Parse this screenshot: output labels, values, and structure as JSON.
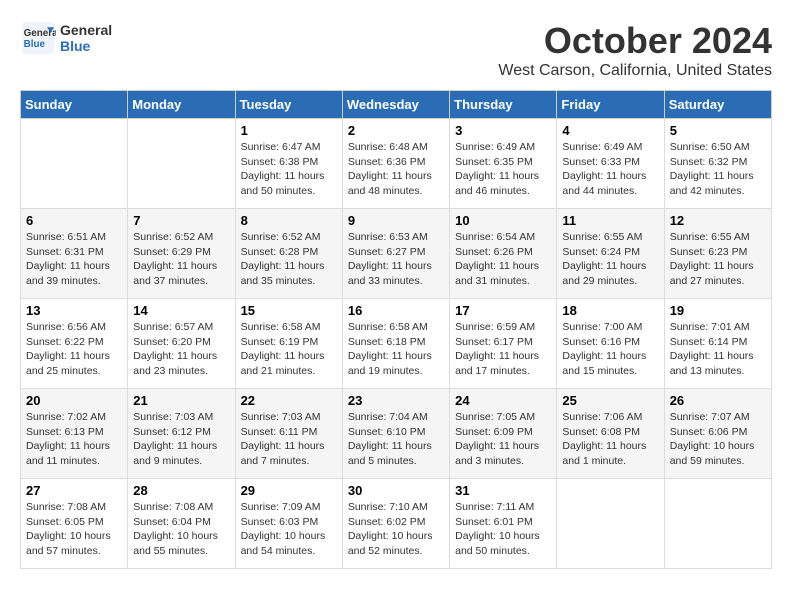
{
  "header": {
    "logo_line1": "General",
    "logo_line2": "Blue",
    "month": "October 2024",
    "location": "West Carson, California, United States"
  },
  "days_of_week": [
    "Sunday",
    "Monday",
    "Tuesday",
    "Wednesday",
    "Thursday",
    "Friday",
    "Saturday"
  ],
  "weeks": [
    [
      {
        "day": "",
        "content": ""
      },
      {
        "day": "",
        "content": ""
      },
      {
        "day": "1",
        "content": "Sunrise: 6:47 AM\nSunset: 6:38 PM\nDaylight: 11 hours and 50 minutes."
      },
      {
        "day": "2",
        "content": "Sunrise: 6:48 AM\nSunset: 6:36 PM\nDaylight: 11 hours and 48 minutes."
      },
      {
        "day": "3",
        "content": "Sunrise: 6:49 AM\nSunset: 6:35 PM\nDaylight: 11 hours and 46 minutes."
      },
      {
        "day": "4",
        "content": "Sunrise: 6:49 AM\nSunset: 6:33 PM\nDaylight: 11 hours and 44 minutes."
      },
      {
        "day": "5",
        "content": "Sunrise: 6:50 AM\nSunset: 6:32 PM\nDaylight: 11 hours and 42 minutes."
      }
    ],
    [
      {
        "day": "6",
        "content": "Sunrise: 6:51 AM\nSunset: 6:31 PM\nDaylight: 11 hours and 39 minutes."
      },
      {
        "day": "7",
        "content": "Sunrise: 6:52 AM\nSunset: 6:29 PM\nDaylight: 11 hours and 37 minutes."
      },
      {
        "day": "8",
        "content": "Sunrise: 6:52 AM\nSunset: 6:28 PM\nDaylight: 11 hours and 35 minutes."
      },
      {
        "day": "9",
        "content": "Sunrise: 6:53 AM\nSunset: 6:27 PM\nDaylight: 11 hours and 33 minutes."
      },
      {
        "day": "10",
        "content": "Sunrise: 6:54 AM\nSunset: 6:26 PM\nDaylight: 11 hours and 31 minutes."
      },
      {
        "day": "11",
        "content": "Sunrise: 6:55 AM\nSunset: 6:24 PM\nDaylight: 11 hours and 29 minutes."
      },
      {
        "day": "12",
        "content": "Sunrise: 6:55 AM\nSunset: 6:23 PM\nDaylight: 11 hours and 27 minutes."
      }
    ],
    [
      {
        "day": "13",
        "content": "Sunrise: 6:56 AM\nSunset: 6:22 PM\nDaylight: 11 hours and 25 minutes."
      },
      {
        "day": "14",
        "content": "Sunrise: 6:57 AM\nSunset: 6:20 PM\nDaylight: 11 hours and 23 minutes."
      },
      {
        "day": "15",
        "content": "Sunrise: 6:58 AM\nSunset: 6:19 PM\nDaylight: 11 hours and 21 minutes."
      },
      {
        "day": "16",
        "content": "Sunrise: 6:58 AM\nSunset: 6:18 PM\nDaylight: 11 hours and 19 minutes."
      },
      {
        "day": "17",
        "content": "Sunrise: 6:59 AM\nSunset: 6:17 PM\nDaylight: 11 hours and 17 minutes."
      },
      {
        "day": "18",
        "content": "Sunrise: 7:00 AM\nSunset: 6:16 PM\nDaylight: 11 hours and 15 minutes."
      },
      {
        "day": "19",
        "content": "Sunrise: 7:01 AM\nSunset: 6:14 PM\nDaylight: 11 hours and 13 minutes."
      }
    ],
    [
      {
        "day": "20",
        "content": "Sunrise: 7:02 AM\nSunset: 6:13 PM\nDaylight: 11 hours and 11 minutes."
      },
      {
        "day": "21",
        "content": "Sunrise: 7:03 AM\nSunset: 6:12 PM\nDaylight: 11 hours and 9 minutes."
      },
      {
        "day": "22",
        "content": "Sunrise: 7:03 AM\nSunset: 6:11 PM\nDaylight: 11 hours and 7 minutes."
      },
      {
        "day": "23",
        "content": "Sunrise: 7:04 AM\nSunset: 6:10 PM\nDaylight: 11 hours and 5 minutes."
      },
      {
        "day": "24",
        "content": "Sunrise: 7:05 AM\nSunset: 6:09 PM\nDaylight: 11 hours and 3 minutes."
      },
      {
        "day": "25",
        "content": "Sunrise: 7:06 AM\nSunset: 6:08 PM\nDaylight: 11 hours and 1 minute."
      },
      {
        "day": "26",
        "content": "Sunrise: 7:07 AM\nSunset: 6:06 PM\nDaylight: 10 hours and 59 minutes."
      }
    ],
    [
      {
        "day": "27",
        "content": "Sunrise: 7:08 AM\nSunset: 6:05 PM\nDaylight: 10 hours and 57 minutes."
      },
      {
        "day": "28",
        "content": "Sunrise: 7:08 AM\nSunset: 6:04 PM\nDaylight: 10 hours and 55 minutes."
      },
      {
        "day": "29",
        "content": "Sunrise: 7:09 AM\nSunset: 6:03 PM\nDaylight: 10 hours and 54 minutes."
      },
      {
        "day": "30",
        "content": "Sunrise: 7:10 AM\nSunset: 6:02 PM\nDaylight: 10 hours and 52 minutes."
      },
      {
        "day": "31",
        "content": "Sunrise: 7:11 AM\nSunset: 6:01 PM\nDaylight: 10 hours and 50 minutes."
      },
      {
        "day": "",
        "content": ""
      },
      {
        "day": "",
        "content": ""
      }
    ]
  ]
}
